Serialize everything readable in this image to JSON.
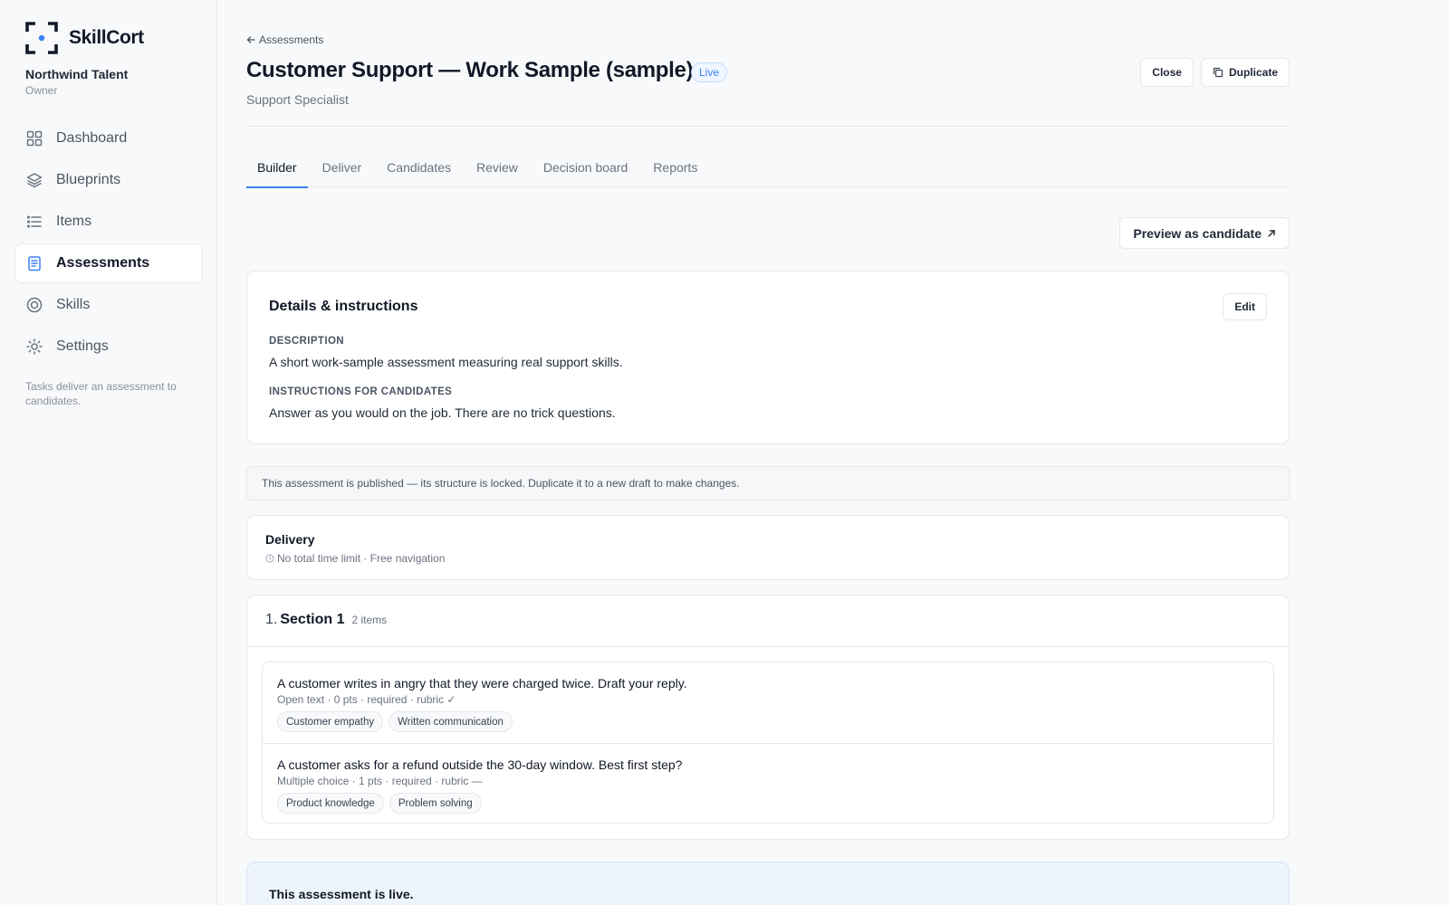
{
  "brand": {
    "name": "SkillCort",
    "accent": "#3b82f6"
  },
  "org": {
    "name": "Northwind Talent",
    "role": "Owner"
  },
  "nav": [
    {
      "label": "Dashboard",
      "icon": "dashboard-icon"
    },
    {
      "label": "Blueprints",
      "icon": "layers-icon"
    },
    {
      "label": "Items",
      "icon": "list-icon"
    },
    {
      "label": "Assessments",
      "icon": "clipboard-icon",
      "active": true
    },
    {
      "label": "Skills",
      "icon": "target-icon"
    },
    {
      "label": "Settings",
      "icon": "sun-icon"
    }
  ],
  "sidebar_note": "Tasks deliver an assessment to candidates.",
  "header": {
    "back_label": "Assessments",
    "title": "Customer Support — Work Sample (sample)",
    "status_badge": "Live",
    "subtitle": "Support Specialist",
    "close_label": "Close",
    "duplicate_label": "Duplicate"
  },
  "tabs": [
    "Builder",
    "Deliver",
    "Candidates",
    "Review",
    "Decision board",
    "Reports"
  ],
  "active_tab": "Builder",
  "preview_label": "Preview as candidate",
  "details": {
    "title": "Details & instructions",
    "edit_label": "Edit",
    "description_label": "Description",
    "description": "A short work-sample assessment measuring real support skills.",
    "instructions_label": "Instructions for candidates",
    "instructions": "Answer as you would on the job. There are no trick questions."
  },
  "notice": "This assessment is published — its structure is locked. Duplicate it to a new draft to make changes.",
  "delivery": {
    "title": "Delivery",
    "meta": "No total time limit · Free navigation"
  },
  "section": {
    "number": "1.",
    "name": "Section 1",
    "count": "2 items",
    "items": [
      {
        "title": "A customer writes in angry that they were charged twice. Draft your reply.",
        "meta": "Open text · 0 pts · required · rubric ✓",
        "tags": [
          "Customer empathy",
          "Written communication"
        ]
      },
      {
        "title": "A customer asks for a refund outside the 30-day window. Best first step?",
        "meta": "Multiple choice · 1 pts · required · rubric —",
        "tags": [
          "Product knowledge",
          "Problem solving"
        ]
      }
    ]
  },
  "live_banner": {
    "title": "This assessment is live."
  }
}
